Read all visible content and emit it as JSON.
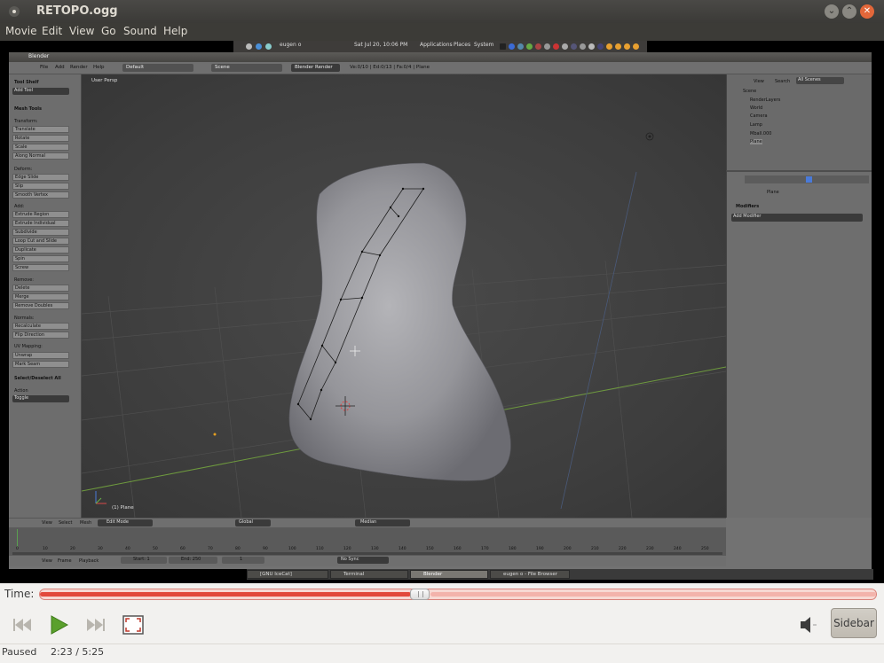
{
  "window": {
    "title": "RETOPO.ogg"
  },
  "menubar": {
    "items": [
      "Movie",
      "Edit",
      "View",
      "Go",
      "Sound",
      "Help"
    ]
  },
  "gnome_panel": {
    "user": "eugen o",
    "datetime": "Sat Jul 20, 10:06 PM",
    "menus": [
      "Applications",
      "Places",
      "System"
    ]
  },
  "blender": {
    "window_title": "Blender",
    "header": {
      "menus": [
        "File",
        "Add",
        "Render",
        "Help"
      ],
      "screen_layout": "Default",
      "scene": "Scene",
      "engine": "Blender Render",
      "stats": "Ve:0/10 | Ed:0/13 | Fa:0/4 | Plane"
    },
    "tool_shelf": {
      "title": "Tool Shelf",
      "add_tool": "Add Tool",
      "mesh_tools": "Mesh Tools",
      "transform_label": "Transform:",
      "transform": [
        "Translate",
        "Rotate",
        "Scale",
        "Along Normal"
      ],
      "deform_label": "Deform:",
      "deform": [
        "Edge Slide",
        "Slip",
        "Smooth Vertex"
      ],
      "add_label": "Add:",
      "add": [
        "Extrude Region",
        "Extrude Individual",
        "Subdivide",
        "Loop Cut and Slide",
        "Duplicate",
        "Spin",
        "Screw"
      ],
      "remove_label": "Remove:",
      "remove": [
        "Delete",
        "Merge",
        "Remove Doubles"
      ],
      "normals_label": "Normals:",
      "normals": [
        "Recalculate",
        "Flip Direction"
      ],
      "uv_label": "UV Mapping:",
      "uv": [
        "Unwrap",
        "Mark Seam"
      ],
      "select_section": "Select/Deselect All",
      "action_label": "Action",
      "action_value": "Toggle"
    },
    "viewport": {
      "label": "User Persp",
      "object_label": "(1) Plane"
    },
    "outliner": {
      "view": "View",
      "search": "Search",
      "filter": "All Scenes",
      "items": [
        "Scene",
        "RenderLayers",
        "World",
        "Camera",
        "Lamp",
        "Mball.000",
        "Plane"
      ]
    },
    "properties": {
      "object_name": "Plane",
      "modifiers_title": "Modifiers",
      "add_modifier": "Add Modifier"
    },
    "viewport_header": {
      "menus": [
        "View",
        "Select",
        "Mesh"
      ],
      "mode": "Edit Mode",
      "orientation": "Global",
      "pivot": "Median"
    },
    "timeline": {
      "ticks": [
        "0",
        "10",
        "20",
        "30",
        "40",
        "50",
        "60",
        "70",
        "80",
        "90",
        "100",
        "110",
        "120",
        "130",
        "140",
        "150",
        "160",
        "170",
        "180",
        "190",
        "200",
        "210",
        "220",
        "230",
        "240",
        "250"
      ],
      "menus": [
        "View",
        "Frame",
        "Playback"
      ],
      "start": "Start: 1",
      "end": "End: 250",
      "current": "1",
      "sync": "No Sync"
    }
  },
  "taskbar": {
    "tasks": [
      "[GNU IceCat]",
      "Terminal",
      "Blender",
      "eugen o - File Browser"
    ],
    "active_index": 2
  },
  "player": {
    "time_label": "Time:",
    "progress": 0.443,
    "status": "Paused",
    "position": "2:23 / 5:25",
    "sidebar_label": "Sidebar",
    "accent": "#e24a3c"
  }
}
